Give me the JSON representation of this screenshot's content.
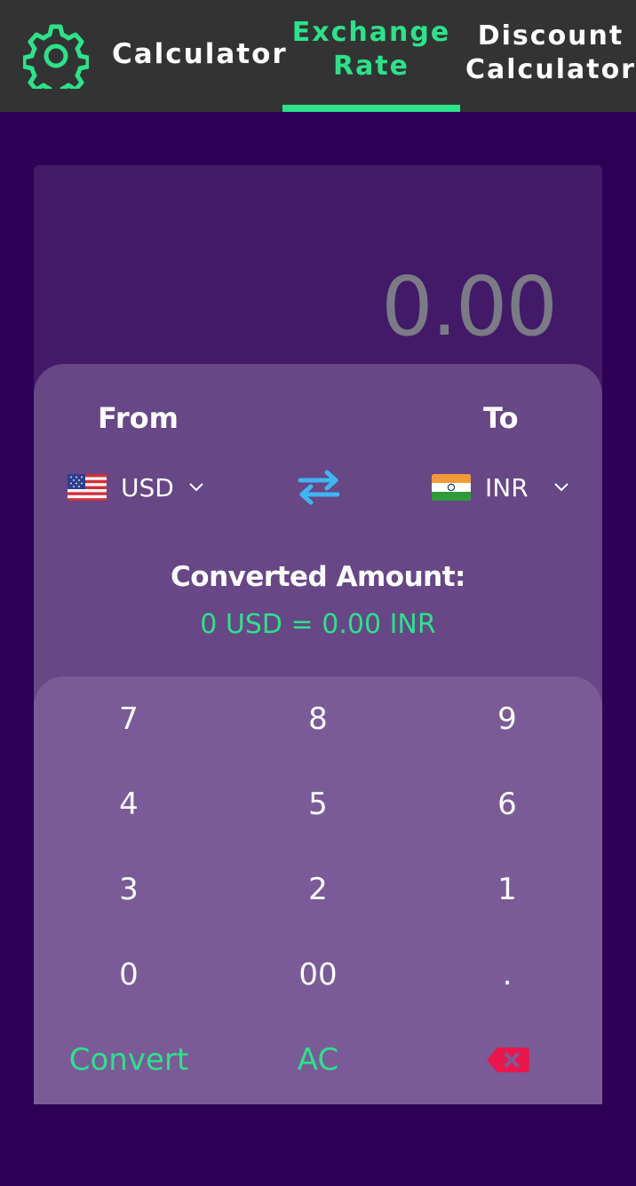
{
  "header": {
    "tabs": [
      {
        "label": "Calculator"
      },
      {
        "label": "Exchange Rate",
        "line1": "Exchange",
        "line2": "Rate"
      },
      {
        "label": "Discount Calculator",
        "line1": "Discount",
        "line2": "Calculator"
      }
    ],
    "active_tab": "Exchange Rate",
    "accent_color": "#2be38a"
  },
  "display": {
    "value": "0.00"
  },
  "converter": {
    "from_label": "From",
    "to_label": "To",
    "from_currency": "USD",
    "to_currency": "INR",
    "from_flag": "us-flag-icon",
    "to_flag": "india-flag-icon",
    "swap_icon": "swap-arrows-icon",
    "result_title": "Converted Amount:",
    "result_text": "0 USD = 0.00 INR"
  },
  "keypad": {
    "rows": [
      [
        "7",
        "8",
        "9"
      ],
      [
        "4",
        "5",
        "6"
      ],
      [
        "3",
        "2",
        "1"
      ],
      [
        "0",
        "00",
        "."
      ]
    ],
    "convert_label": "Convert",
    "clear_label": "AC",
    "backspace_icon": "backspace-icon"
  }
}
